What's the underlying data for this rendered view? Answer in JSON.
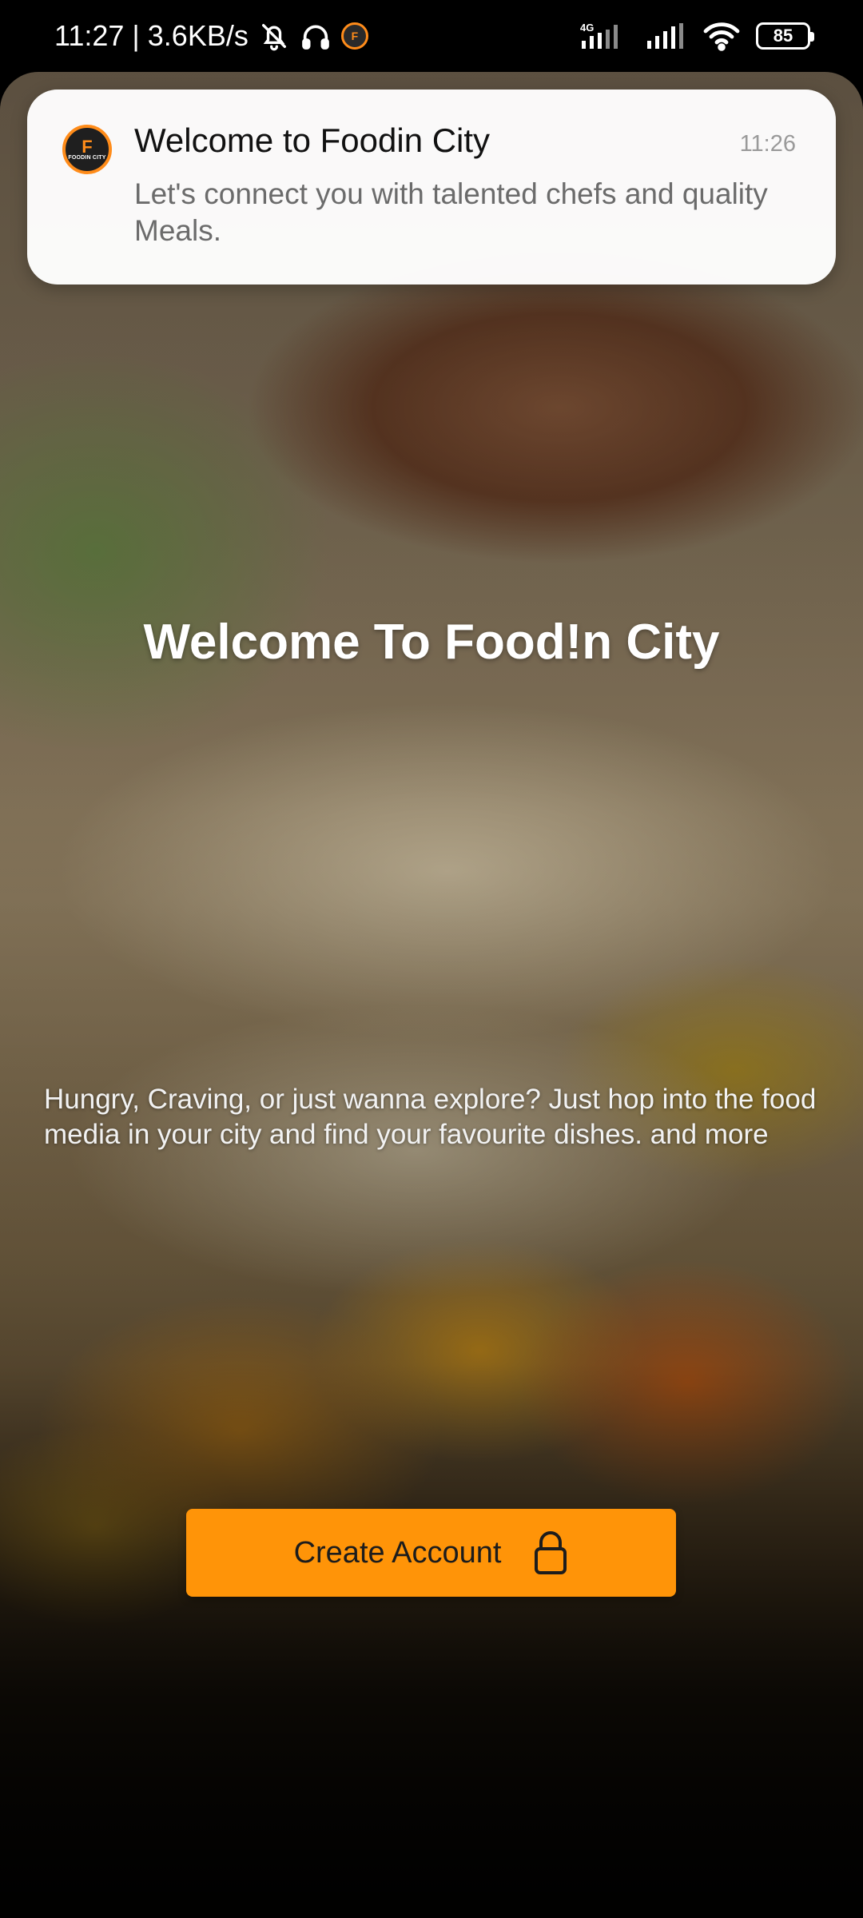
{
  "status_bar": {
    "time_speed": "11:27 | 3.6KB/s",
    "network_label": "4G",
    "battery": "85",
    "icons": [
      "mute-icon",
      "headphones-icon",
      "app-notification-icon",
      "signal-icon",
      "signal-icon",
      "wifi-icon",
      "battery-icon"
    ]
  },
  "notification": {
    "app_logo_letter": "F",
    "app_logo_text": "FOODIN CITY",
    "title": "Welcome to Foodin City",
    "time": "11:26",
    "body": "Let's connect you with talented chefs and quality Meals."
  },
  "main": {
    "headline": "Welcome To Food!n City",
    "description": "Hungry, Craving, or just wanna explore? Just hop into the food media in your city and find your favourite dishes. and more",
    "cta_label": "Create Account",
    "cta_icon": "lock-icon"
  },
  "colors": {
    "accent": "#ff9408",
    "logo_ring": "#ff8c1a"
  }
}
